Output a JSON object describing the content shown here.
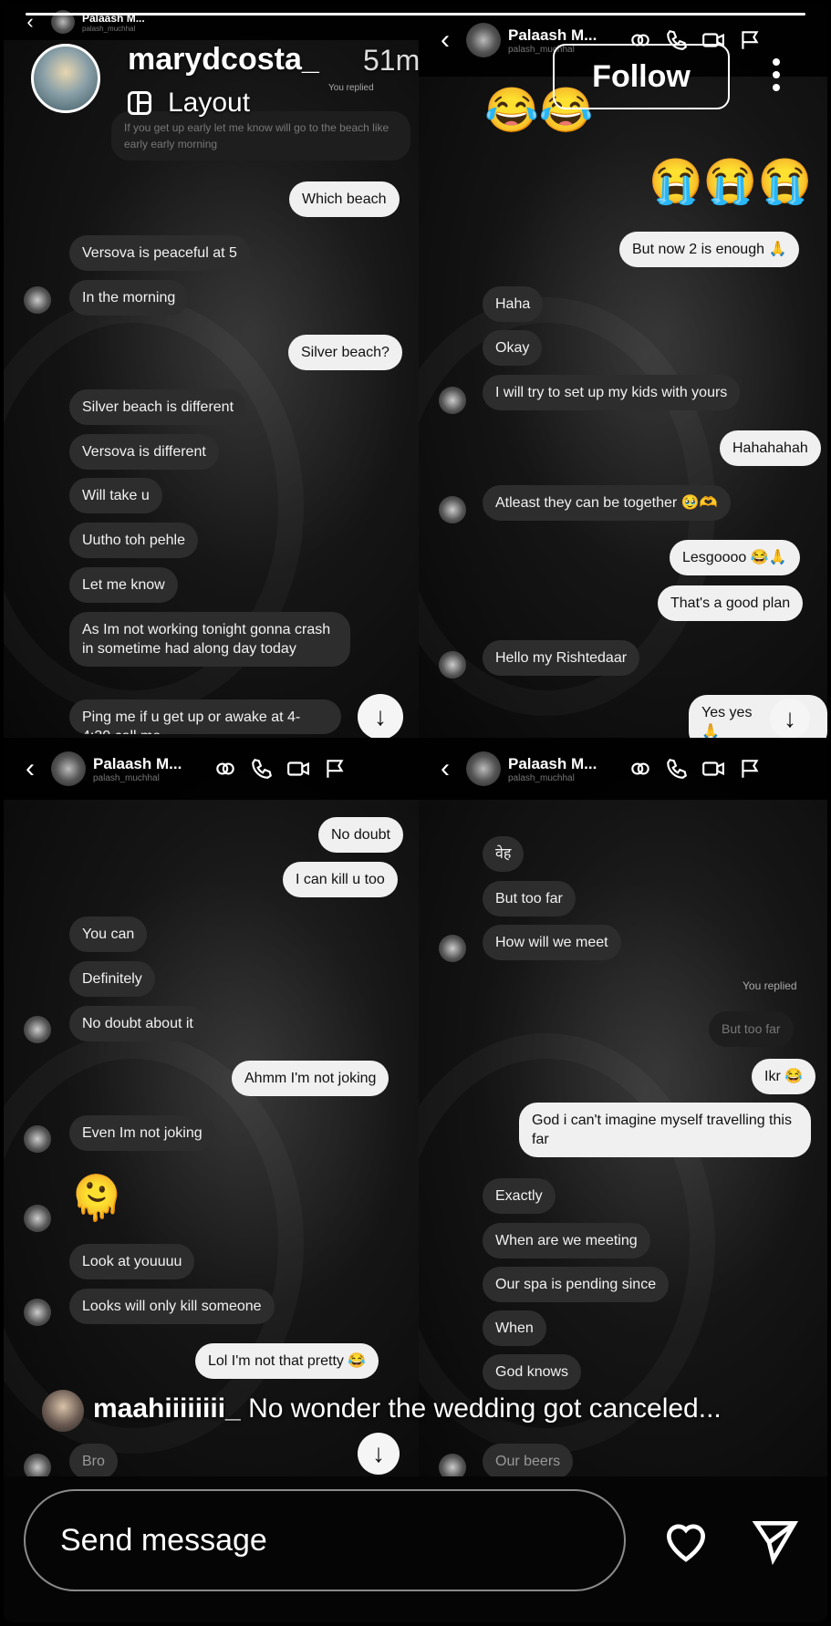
{
  "story": {
    "username": "marydcosta_",
    "time": "51m",
    "layout_label": "Layout",
    "follow_label": "Follow",
    "more_icon": "more-vertical-icon"
  },
  "chat_header": {
    "name": "Palaash M...",
    "handle": "palash_muchhal"
  },
  "p1": {
    "you_replied": "You replied",
    "quoted": "If you get up early let me know will go to the beach like early early morning",
    "m1": "Which beach",
    "m2": "Versova is peaceful at 5",
    "m3": "In the morning",
    "m4": "Silver beach?",
    "m5": "Silver beach is different",
    "m6": "Versova is different",
    "m7": "Will take u",
    "m8": "Uutho toh pehle",
    "m9": "Let me know",
    "m10": "As Im not working tonight gonna crash in sometime had along day today",
    "m11": "Ping me if u get up or awake at 4-4:30 call me"
  },
  "p2": {
    "emoji_laugh": "😂😂",
    "emoji_cry": "😭😭😭",
    "m1": "But now 2 is enough 🙏",
    "m2": "Haha",
    "m3": "Okay",
    "m4": "I will try to set up my kids with yours",
    "m5": "Hahahahah",
    "m6": "Atleast they can be together 🥹🫶",
    "m7": "Lesgoooo 😂🙏",
    "m8": "That's a good plan",
    "m9": "Hello my Rishtedaar",
    "m10": "Yes yes 🙏"
  },
  "p3": {
    "m1": "No doubt",
    "m2": "I can kill u too",
    "m3": "You can",
    "m4": "Definitely",
    "m5": "No doubt about it",
    "m6": "Ahmm I'm not joking",
    "m7": "Even Im not joking",
    "emoji": "🫠",
    "m8": "Look at youuuu",
    "m9": "Looks will only kill someone",
    "m10": "Lol I'm not that pretty 😂",
    "m11": "Bro"
  },
  "p4": {
    "m1": "वेह",
    "m2": "But too far",
    "m3": "How will we meet",
    "you_replied": "You replied",
    "quoted": "But too far",
    "m4": "Ikr 😂",
    "m5": "God i can't imagine myself travelling this far",
    "m6": "Exactly",
    "m7": "When are we meeting",
    "m8": "Our spa is pending since",
    "m9": "When",
    "m10": "God knows",
    "m11": "Our beers"
  },
  "comment": {
    "user": "maahiiiiiiii_",
    "text": "No wonder the wedding got canceled..."
  },
  "footer": {
    "placeholder": "Send message"
  }
}
